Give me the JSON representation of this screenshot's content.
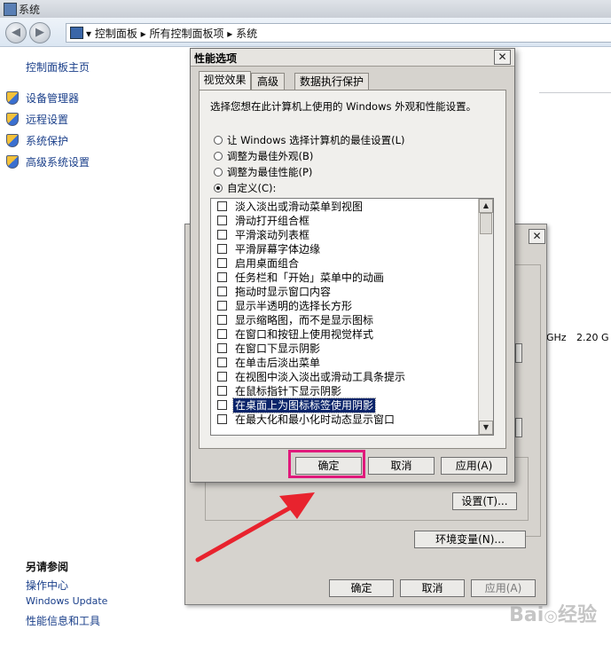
{
  "window": {
    "title": "系统"
  },
  "address": {
    "crumbs": "▾ 控制面板 ▸ 所有控制面板项 ▸ 系统"
  },
  "nav": {
    "back": "◀",
    "forward": "▶"
  },
  "left_pane": {
    "home": "控制面板主页",
    "items": [
      "设备管理器",
      "远程设置",
      "系统保护",
      "高级系统设置"
    ],
    "see_also_title": "另请参阅",
    "see_also": [
      "操作中心",
      "Windows Update",
      "性能信息和工具"
    ]
  },
  "right_fragments": {
    "cpu_a": "GHz",
    "cpu_b": "2.20 G"
  },
  "back_dialog": {
    "close": "✕",
    "settings_btn": "设置(T)...",
    "env_btn": "环境变量(N)...",
    "ok": "确定",
    "cancel": "取消",
    "apply": "应用(A)"
  },
  "dialog": {
    "title": "性能选项",
    "close": "✕",
    "tabs": [
      "视觉效果",
      "高级",
      "数据执行保护"
    ],
    "description": "选择您想在此计算机上使用的 Windows 外观和性能设置。",
    "radios": [
      {
        "label": "让 Windows 选择计算机的最佳设置(L)",
        "checked": false
      },
      {
        "label": "调整为最佳外观(B)",
        "checked": false
      },
      {
        "label": "调整为最佳性能(P)",
        "checked": false
      },
      {
        "label": "自定义(C):",
        "checked": true
      }
    ],
    "options": [
      "淡入淡出或滑动菜单到视图",
      "滑动打开组合框",
      "平滑滚动列表框",
      "平滑屏幕字体边缘",
      "启用桌面组合",
      "任务栏和「开始」菜单中的动画",
      "拖动时显示窗口内容",
      "显示半透明的选择长方形",
      "显示缩略图，而不是显示图标",
      "在窗口和按钮上使用视觉样式",
      "在窗口下显示阴影",
      "在单击后淡出菜单",
      "在视图中淡入淡出或滑动工具条提示",
      "在鼠标指针下显示阴影",
      "在桌面上为图标标签使用阴影",
      "在最大化和最小化时动态显示窗口"
    ],
    "selected_index": 14,
    "buttons": {
      "ok": "确定",
      "cancel": "取消",
      "apply": "应用(A)"
    },
    "scroll_up": "▲",
    "scroll_down": "▼"
  },
  "colors": {
    "highlight_box": "#e0197b",
    "arrow": "#e8232e",
    "selection": "#0a246a"
  }
}
